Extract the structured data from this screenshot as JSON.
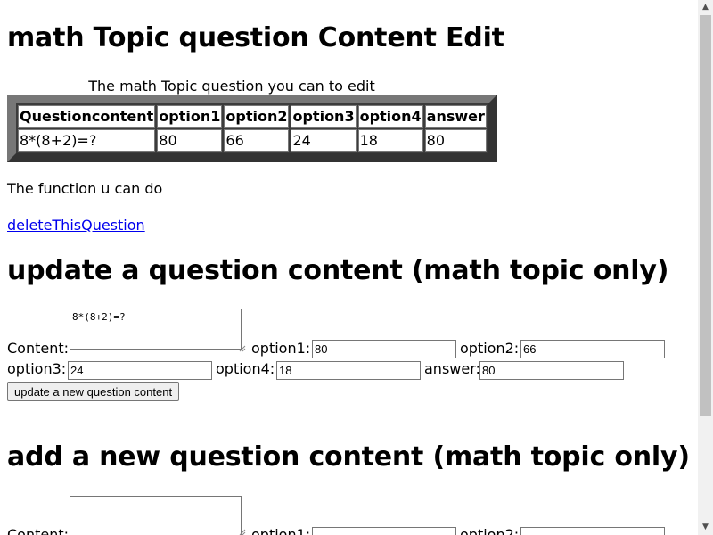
{
  "page_title": "math Topic question Content Edit",
  "table": {
    "caption": "The math Topic question you can to edit",
    "headers": [
      "Questioncontent",
      "option1",
      "option2",
      "option3",
      "option4",
      "answer"
    ],
    "row": [
      "8*(8+2)=?",
      "80",
      "66",
      "24",
      "18",
      "80"
    ]
  },
  "functions_text": "The function u can do",
  "delete_link": "deleteThisQuestion",
  "update_form": {
    "heading": "update a question content (math topic only)",
    "content_label": "Content:",
    "content_value": "8*(8+2)=?",
    "option1_label": "option1:",
    "option1_value": "80",
    "option2_label": "option2:",
    "option2_value": "66",
    "option3_label": "option3:",
    "option3_value": "24",
    "option4_label": "option4:",
    "option4_value": "18",
    "answer_label": "answer:",
    "answer_value": "80",
    "submit_label": "update a new question content"
  },
  "add_form": {
    "heading": "add a new question content (math topic only)",
    "content_label": "Content:",
    "content_value": "",
    "option1_label": "option1:",
    "option1_value": "",
    "option2_label": "option2:",
    "option2_value": ""
  },
  "scrollbar": {
    "up_icon": "arrow-up-icon",
    "down_icon": "arrow-down-icon"
  }
}
